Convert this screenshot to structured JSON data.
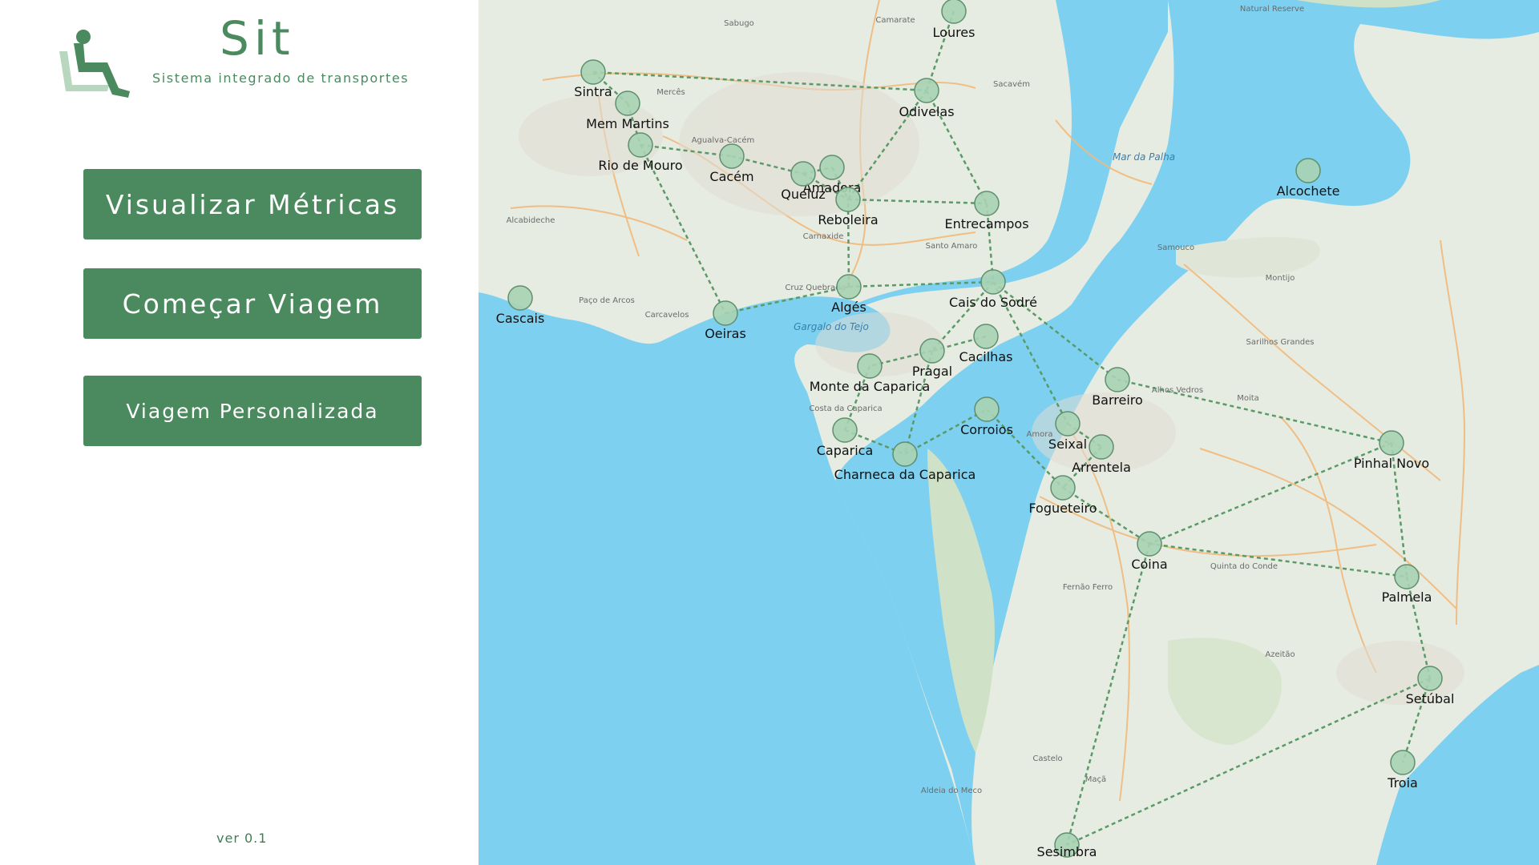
{
  "app": {
    "title": "Sit",
    "subtitle": "Sistema integrado de transportes",
    "version": "ver 0.1",
    "logo_icon": "accessible-seat-icon"
  },
  "menu": {
    "metrics": "Visualizar Métricas",
    "start_trip": "Começar Viagem",
    "custom_trip": "Viagem Personalizada"
  },
  "colors": {
    "accent": "#4a8a5e",
    "water": "#7dd0ef",
    "land": "#e6ece1",
    "station_fill": "#a9d3b4",
    "station_stroke": "#5e8f6e",
    "route": "#5a9a68"
  },
  "map": {
    "stations": [
      {
        "id": "loures",
        "name": "Loures"
      },
      {
        "id": "sintra",
        "name": "Sintra"
      },
      {
        "id": "memmartins",
        "name": "Mem Martins"
      },
      {
        "id": "odivelas",
        "name": "Odivelas"
      },
      {
        "id": "riodemouro",
        "name": "Rio de Mouro"
      },
      {
        "id": "cacem",
        "name": "Cacém"
      },
      {
        "id": "amadora",
        "name": "Amadora"
      },
      {
        "id": "queluz",
        "name": "Queluz"
      },
      {
        "id": "reboleira",
        "name": "Reboleira"
      },
      {
        "id": "entrecampos",
        "name": "Entrecampos"
      },
      {
        "id": "alcochete",
        "name": "Alcochete"
      },
      {
        "id": "cascais",
        "name": "Cascais"
      },
      {
        "id": "oeiras",
        "name": "Oeiras"
      },
      {
        "id": "alges",
        "name": "Algés"
      },
      {
        "id": "caisdosodre",
        "name": "Cais do Sodré"
      },
      {
        "id": "cacilhas",
        "name": "Cacilhas"
      },
      {
        "id": "pragal",
        "name": "Pragal"
      },
      {
        "id": "montedacaparica",
        "name": "Monte da Caparica"
      },
      {
        "id": "barreiro",
        "name": "Barreiro"
      },
      {
        "id": "corroios",
        "name": "Corroios"
      },
      {
        "id": "seixal",
        "name": "Seixal"
      },
      {
        "id": "arrentela",
        "name": "Arrentela"
      },
      {
        "id": "caparica",
        "name": "Caparica"
      },
      {
        "id": "charneca",
        "name": "Charneca da Caparica"
      },
      {
        "id": "fogueteiro",
        "name": "Fogueteiro"
      },
      {
        "id": "pinhalnovo",
        "name": "Pinhal Novo"
      },
      {
        "id": "coina",
        "name": "Coina"
      },
      {
        "id": "palmela",
        "name": "Palmela"
      },
      {
        "id": "setubal",
        "name": "Setúbal"
      },
      {
        "id": "troia",
        "name": "Troia"
      },
      {
        "id": "sesimbra",
        "name": "Sesimbra"
      }
    ],
    "routes": [
      [
        "sintra",
        "odivelas"
      ],
      [
        "sintra",
        "memmartins"
      ],
      [
        "memmartins",
        "riodemouro"
      ],
      [
        "riodemouro",
        "cacem"
      ],
      [
        "riodemouro",
        "oeiras"
      ],
      [
        "cacem",
        "queluz"
      ],
      [
        "queluz",
        "amadora"
      ],
      [
        "queluz",
        "reboleira"
      ],
      [
        "amadora",
        "reboleira"
      ],
      [
        "reboleira",
        "entrecampos"
      ],
      [
        "loures",
        "odivelas"
      ],
      [
        "odivelas",
        "entrecampos"
      ],
      [
        "odivelas",
        "reboleira"
      ],
      [
        "entrecampos",
        "caisdosodre"
      ],
      [
        "oeiras",
        "alges"
      ],
      [
        "alges",
        "caisdosodre"
      ],
      [
        "alges",
        "reboleira"
      ],
      [
        "caisdosodre",
        "pragal"
      ],
      [
        "caisdosodre",
        "barreiro"
      ],
      [
        "caisdosodre",
        "seixal"
      ],
      [
        "cacilhas",
        "pragal"
      ],
      [
        "pragal",
        "montedacaparica"
      ],
      [
        "pragal",
        "charneca"
      ],
      [
        "montedacaparica",
        "caparica"
      ],
      [
        "caparica",
        "charneca"
      ],
      [
        "charneca",
        "corroios"
      ],
      [
        "corroios",
        "fogueteiro"
      ],
      [
        "fogueteiro",
        "coina"
      ],
      [
        "seixal",
        "arrentela"
      ],
      [
        "arrentela",
        "fogueteiro"
      ],
      [
        "barreiro",
        "pinhalnovo"
      ],
      [
        "pinhalnovo",
        "coina"
      ],
      [
        "pinhalnovo",
        "palmela"
      ],
      [
        "coina",
        "palmela"
      ],
      [
        "coina",
        "sesimbra"
      ],
      [
        "palmela",
        "setubal"
      ],
      [
        "setubal",
        "troia"
      ],
      [
        "setubal",
        "sesimbra"
      ]
    ],
    "place_labels": [
      {
        "name": "Sabugo"
      },
      {
        "name": "Camarate"
      },
      {
        "name": "Sacavém"
      },
      {
        "name": "Mercês"
      },
      {
        "name": "Agualva-Cacém"
      },
      {
        "name": "Alcabideche"
      },
      {
        "name": "Carnaxide"
      },
      {
        "name": "Paço de Arcos"
      },
      {
        "name": "Carcavelos"
      },
      {
        "name": "Samouco"
      },
      {
        "name": "Montijo"
      },
      {
        "name": "Moita"
      },
      {
        "name": "Alhos Vedros"
      },
      {
        "name": "Costa da Caparica"
      },
      {
        "name": "Amora"
      },
      {
        "name": "Quinta do Conde"
      },
      {
        "name": "Azeitão"
      },
      {
        "name": "Fernão Ferro"
      },
      {
        "name": "Sarilhos Grandes"
      },
      {
        "name": "Castelo"
      },
      {
        "name": "Maçã"
      },
      {
        "name": "Aldeia do Meco"
      },
      {
        "name": "Cruz Quebrada"
      },
      {
        "name": "Santo Amaro"
      },
      {
        "name": "Natural Reserve"
      }
    ],
    "water_labels": [
      {
        "name": "Mar da Palha"
      },
      {
        "name": "Gargalo do Tejo"
      }
    ]
  }
}
